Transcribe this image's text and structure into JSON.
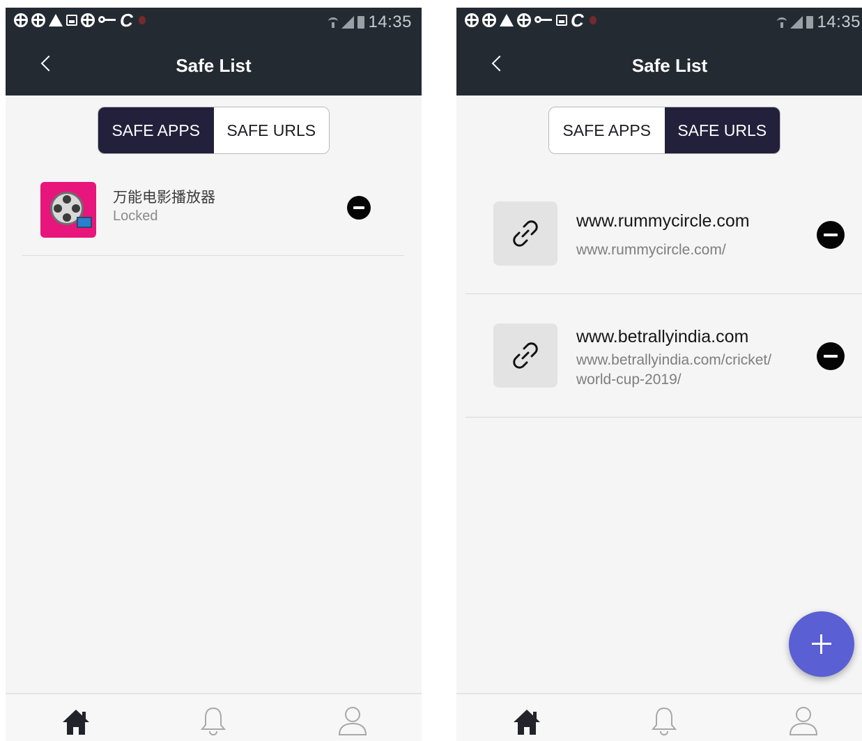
{
  "status_bar": {
    "time": "14:35",
    "notification_icons": [
      "circle-plus-icon",
      "circle-plus-icon",
      "warning-icon",
      "picture-icon",
      "circle-plus-icon",
      "key-icon",
      "c-icon",
      "red-dot-icon"
    ]
  },
  "left_screen": {
    "title": "Safe List",
    "tabs": [
      {
        "label": "SAFE APPS",
        "active": true
      },
      {
        "label": "SAFE URLS",
        "active": false
      }
    ],
    "apps": [
      {
        "name": "万能电影播放器",
        "status": "Locked",
        "icon": "movie-reel-icon"
      }
    ]
  },
  "right_screen": {
    "title": "Safe List",
    "tabs": [
      {
        "label": "SAFE APPS",
        "active": false
      },
      {
        "label": "SAFE URLS",
        "active": true
      }
    ],
    "urls": [
      {
        "title": "www.rummycircle.com",
        "url": "www.rummycircle.com/"
      },
      {
        "title": "www.betrallyindia.com",
        "url": "www.betrallyindia.com/cricket/ world-cup-2019/"
      }
    ],
    "fab": "add-icon"
  },
  "bottom_nav": [
    {
      "name": "home",
      "icon": "home-icon",
      "active": true
    },
    {
      "name": "notifications",
      "icon": "bell-icon",
      "active": false
    },
    {
      "name": "profile",
      "icon": "user-icon",
      "active": false
    }
  ],
  "colors": {
    "header": "#242a32",
    "segment_active": "#22203a",
    "fab": "#5a5fd4",
    "app_icon_bg": "#e8157c",
    "background": "#f5f5f5"
  }
}
